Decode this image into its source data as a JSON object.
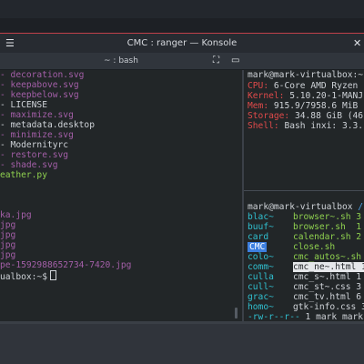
{
  "window": {
    "title": "CMC : ranger — Konsole",
    "menu_icon": "menu-icon",
    "close_icon": "close-icon"
  },
  "tab": {
    "label": "~ : bash",
    "split_icon": "split-view-icon",
    "fullscreen_icon": "fullscreen-icon"
  },
  "left_terminal": {
    "lines": [
      {
        "text": "- decoration.svg",
        "color": "#a45fa8"
      },
      {
        "text": "- keepabove.svg",
        "color": "#a45fa8"
      },
      {
        "text": "- keepbelow.svg",
        "color": "#a45fa8"
      },
      {
        "text": "- LICENSE",
        "color": "#cfd3d8"
      },
      {
        "text": "- maximize.svg",
        "color": "#a45fa8"
      },
      {
        "text": "- metadata.desktop",
        "color": "#cfd3d8"
      },
      {
        "text": "- minimize.svg",
        "color": "#a45fa8"
      },
      {
        "text": "- Modernityrc",
        "color": "#cfd3d8"
      },
      {
        "text": "- restore.svg",
        "color": "#a45fa8"
      },
      {
        "text": "- shade.svg",
        "color": "#a45fa8"
      },
      {
        "text": "eather.py",
        "color": "#8fd14f"
      },
      {
        "text": "",
        "color": "#cfd3d8"
      },
      {
        "text": "",
        "color": "#cfd3d8"
      },
      {
        "text": "",
        "color": "#cfd3d8"
      },
      {
        "text": "ka.jpg",
        "color": "#a45fa8"
      },
      {
        "text": "jpg",
        "color": "#a45fa8"
      },
      {
        "text": "jpg",
        "color": "#a45fa8"
      },
      {
        "text": "jpg",
        "color": "#a45fa8"
      },
      {
        "text": "jpg",
        "color": "#a45fa8"
      },
      {
        "text": "pe-1592988652734-7420.jpg",
        "color": "#a45fa8"
      }
    ],
    "prompt": "ualbox:~$"
  },
  "right_top": {
    "prompt": "mark@mark-virtualbox:~$",
    "fields": [
      {
        "key": "CPU:",
        "value": "6-Core AMD Ryzen"
      },
      {
        "key": "Kernel:",
        "value": "5.10.20-1-MANJ"
      },
      {
        "key": "Mem:",
        "value": "915.9/7958.6 MiB"
      },
      {
        "key": "Storage:",
        "value": "34.88 GiB (46"
      },
      {
        "key": "Shell:",
        "value": "Bash inxi: 3.3."
      }
    ]
  },
  "right_bottom": {
    "prompt": "mark@mark-virtualbox",
    "prompt_path": "/",
    "rows": [
      {
        "dir": "blac~",
        "file": "browser~.sh 3"
      },
      {
        "dir": "buuf~",
        "file": "browser.sh  1"
      },
      {
        "dir": "card",
        "file": "calendar.sh 2"
      },
      {
        "dir": "CMC",
        "file": "close.sh"
      },
      {
        "dir": "colo~",
        "file": "cmc_autos~.sh"
      },
      {
        "dir": "comm~",
        "file": "cmc_ne~.html 1"
      },
      {
        "dir": "culla",
        "file": "cmc_s~.html 1"
      },
      {
        "dir": "cull~",
        "file": "cmc_st~.css 3"
      },
      {
        "dir": "grac~",
        "file": "cmc_tv.html 6"
      },
      {
        "dir": "homo~",
        "file": "gtk-info.css 3"
      }
    ],
    "status": "-rw-r--r--",
    "status_rest": " 1 mark mark"
  },
  "colors": {
    "accent_red": "#c0404a",
    "terminal_bg": "#222628",
    "file_purple": "#a45fa8",
    "exec_green": "#8fd14f",
    "dir_cyan": "#30c0d0",
    "key_red": "#e04a4a",
    "select_blue": "#3d7fe0"
  }
}
